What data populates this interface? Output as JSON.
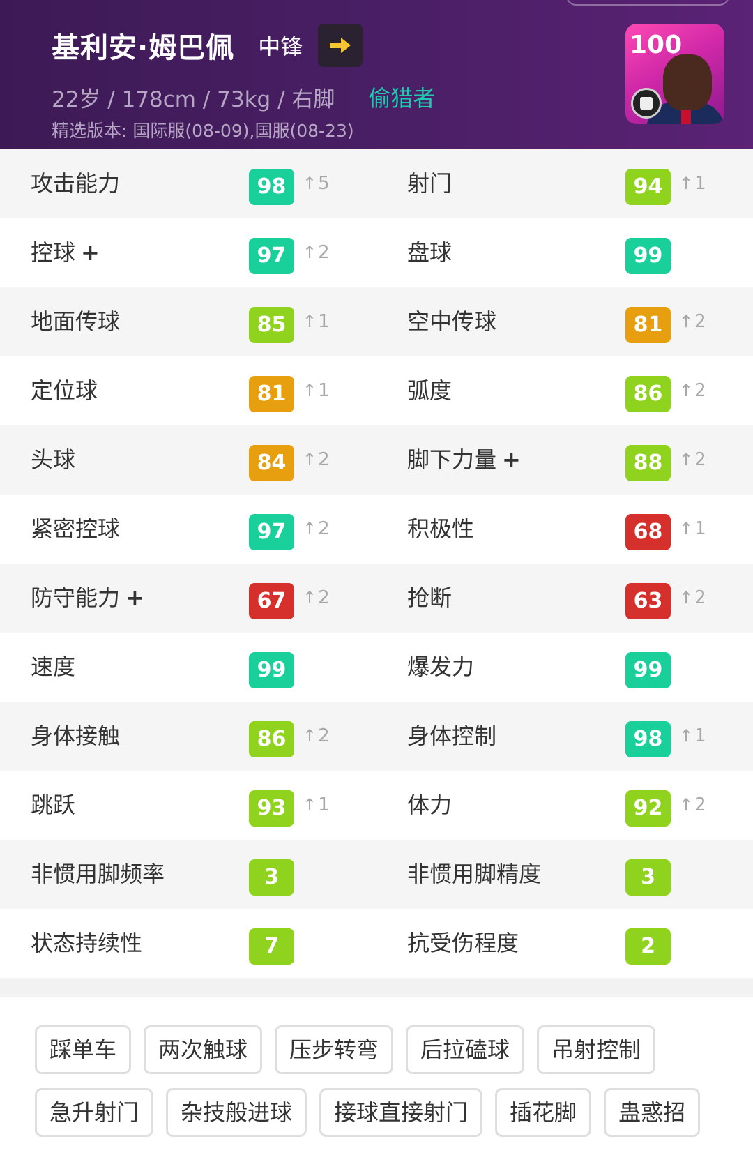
{
  "player": {
    "name": "基利安·姆巴佩",
    "position": "中锋",
    "physical": "22岁 / 178cm / 73kg / 右脚",
    "playstyle": "偷猎者",
    "version": "精选版本: 国际服(08-09),国服(08-23)",
    "card_rating": "100"
  },
  "stats": [
    {
      "left": {
        "label": "攻击能力",
        "plus": false,
        "value": "98",
        "color": "#19cf9a",
        "boost": "5"
      },
      "right": {
        "label": "射门",
        "plus": false,
        "value": "94",
        "color": "#8fd31e",
        "boost": "1"
      }
    },
    {
      "left": {
        "label": "控球",
        "plus": true,
        "value": "97",
        "color": "#19cf9a",
        "boost": "2"
      },
      "right": {
        "label": "盘球",
        "plus": false,
        "value": "99",
        "color": "#19cf9a",
        "boost": ""
      }
    },
    {
      "left": {
        "label": "地面传球",
        "plus": false,
        "value": "85",
        "color": "#8fd31e",
        "boost": "1"
      },
      "right": {
        "label": "空中传球",
        "plus": false,
        "value": "81",
        "color": "#e89f0f",
        "boost": "2"
      }
    },
    {
      "left": {
        "label": "定位球",
        "plus": false,
        "value": "81",
        "color": "#e89f0f",
        "boost": "1"
      },
      "right": {
        "label": "弧度",
        "plus": false,
        "value": "86",
        "color": "#8fd31e",
        "boost": "2"
      }
    },
    {
      "left": {
        "label": "头球",
        "plus": false,
        "value": "84",
        "color": "#e89f0f",
        "boost": "2"
      },
      "right": {
        "label": "脚下力量",
        "plus": true,
        "value": "88",
        "color": "#8fd31e",
        "boost": "2"
      }
    },
    {
      "left": {
        "label": "紧密控球",
        "plus": false,
        "value": "97",
        "color": "#19cf9a",
        "boost": "2"
      },
      "right": {
        "label": "积极性",
        "plus": false,
        "value": "68",
        "color": "#d6302d",
        "boost": "1"
      }
    },
    {
      "left": {
        "label": "防守能力",
        "plus": true,
        "value": "67",
        "color": "#d6302d",
        "boost": "2"
      },
      "right": {
        "label": "抢断",
        "plus": false,
        "value": "63",
        "color": "#d6302d",
        "boost": "2"
      }
    },
    {
      "left": {
        "label": "速度",
        "plus": false,
        "value": "99",
        "color": "#19cf9a",
        "boost": ""
      },
      "right": {
        "label": "爆发力",
        "plus": false,
        "value": "99",
        "color": "#19cf9a",
        "boost": ""
      }
    },
    {
      "left": {
        "label": "身体接触",
        "plus": false,
        "value": "86",
        "color": "#8fd31e",
        "boost": "2"
      },
      "right": {
        "label": "身体控制",
        "plus": false,
        "value": "98",
        "color": "#19cf9a",
        "boost": "1"
      }
    },
    {
      "left": {
        "label": "跳跃",
        "plus": false,
        "value": "93",
        "color": "#8fd31e",
        "boost": "1"
      },
      "right": {
        "label": "体力",
        "plus": false,
        "value": "92",
        "color": "#8fd31e",
        "boost": "2"
      }
    },
    {
      "left": {
        "label": "非惯用脚频率",
        "plus": false,
        "value": "3",
        "color": "#8fd31e",
        "boost": ""
      },
      "right": {
        "label": "非惯用脚精度",
        "plus": false,
        "value": "3",
        "color": "#8fd31e",
        "boost": ""
      }
    },
    {
      "left": {
        "label": "状态持续性",
        "plus": false,
        "value": "7",
        "color": "#8fd31e",
        "boost": ""
      },
      "right": {
        "label": "抗受伤程度",
        "plus": false,
        "value": "2",
        "color": "#8fd31e",
        "boost": ""
      }
    }
  ],
  "skills": [
    [
      "踩单车",
      "两次触球",
      "压步转弯",
      "后拉磕球",
      "吊射控制"
    ],
    [
      "急升射门",
      "杂技般进球",
      "接球直接射门",
      "插花脚",
      "蛊惑招"
    ]
  ],
  "icons": {
    "next": "arrow-right-icon",
    "boost": "arrow-up-icon",
    "plus": "plus-icon"
  },
  "text": {
    "plus_symbol": "+",
    "boost_arrow": "↑"
  }
}
